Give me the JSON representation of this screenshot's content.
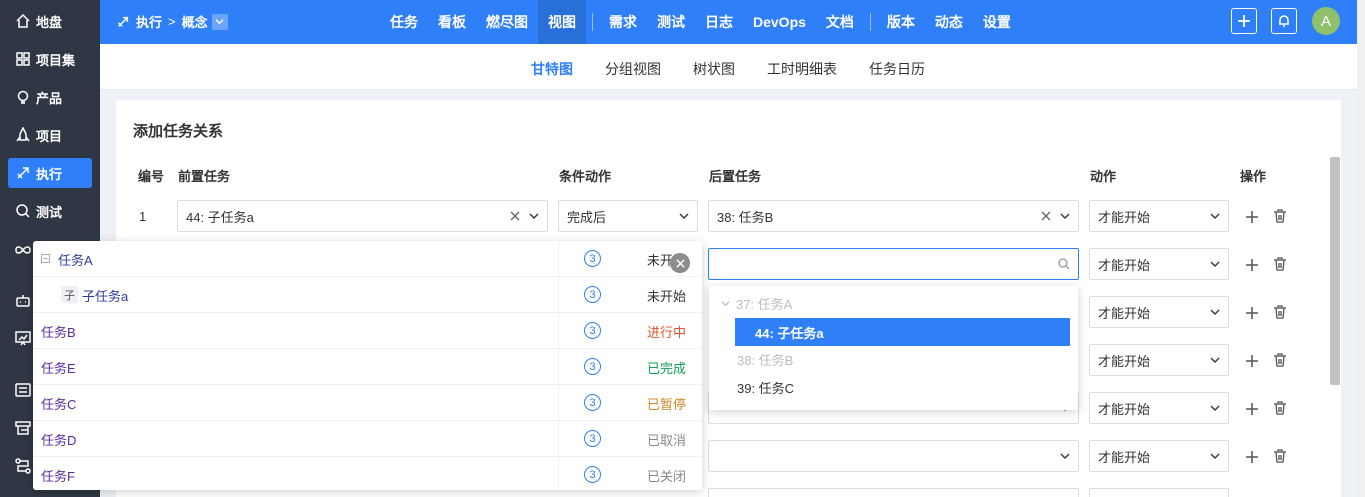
{
  "sidebar": {
    "items": [
      {
        "label": "地盘",
        "icon": "home-icon"
      },
      {
        "label": "项目集",
        "icon": "grid-icon"
      },
      {
        "label": "产品",
        "icon": "bulb-icon"
      },
      {
        "label": "项目",
        "icon": "rocket-icon"
      },
      {
        "label": "执行",
        "icon": "execute-icon",
        "active": true
      },
      {
        "label": "测试",
        "icon": "search-icon"
      }
    ]
  },
  "header": {
    "breadcrumb_root": "执行",
    "breadcrumb_current": "概念",
    "nav": [
      "任务",
      "看板",
      "燃尽图",
      "视图",
      "需求",
      "测试",
      "日志",
      "DevOps",
      "文档",
      "版本",
      "动态",
      "设置"
    ],
    "active_nav": "视图",
    "avatar_letter": "A"
  },
  "subnav": {
    "tabs": [
      "甘特图",
      "分组视图",
      "树状图",
      "工时明细表",
      "任务日历"
    ],
    "active": "甘特图"
  },
  "card": {
    "title": "添加任务关系",
    "columns": {
      "num": "编号",
      "pre": "前置任务",
      "cond": "条件动作",
      "post": "后置任务",
      "action": "动作",
      "ops": "操作"
    },
    "row1": {
      "num": "1",
      "pre": "44: 子任务a",
      "cond": "完成后",
      "post": "38: 任务B",
      "action": "才能开始"
    },
    "action_default": "才能开始",
    "search_placeholder": ""
  },
  "pre_dropdown": {
    "rows": [
      {
        "name": "任务A",
        "count": "3",
        "status": "未开始",
        "status_color": "#333333"
      },
      {
        "name": "子任务a",
        "count": "3",
        "status": "未开始",
        "status_color": "#333333",
        "child_tag": "子"
      },
      {
        "name": "任务B",
        "count": "3",
        "status": "进行中",
        "status_color": "#e2552c"
      },
      {
        "name": "任务E",
        "count": "3",
        "status": "已完成",
        "status_color": "#14a05a"
      },
      {
        "name": "任务C",
        "count": "3",
        "status": "已暂停",
        "status_color": "#d08a24"
      },
      {
        "name": "任务D",
        "count": "3",
        "status": "已取消",
        "status_color": "#888888"
      },
      {
        "name": "任务F",
        "count": "3",
        "status": "已关闭",
        "status_color": "#888888"
      }
    ]
  },
  "post_dropdown": {
    "items": [
      {
        "label": "37: 任务A",
        "state": "disabled-group"
      },
      {
        "label": "44: 子任务a",
        "state": "selected"
      },
      {
        "label": "38: 任务B",
        "state": "disabled"
      },
      {
        "label": "39: 任务C",
        "state": "normal"
      }
    ]
  },
  "colors": {
    "accent": "#2e7ff8",
    "sidebar": "#2f3744"
  }
}
